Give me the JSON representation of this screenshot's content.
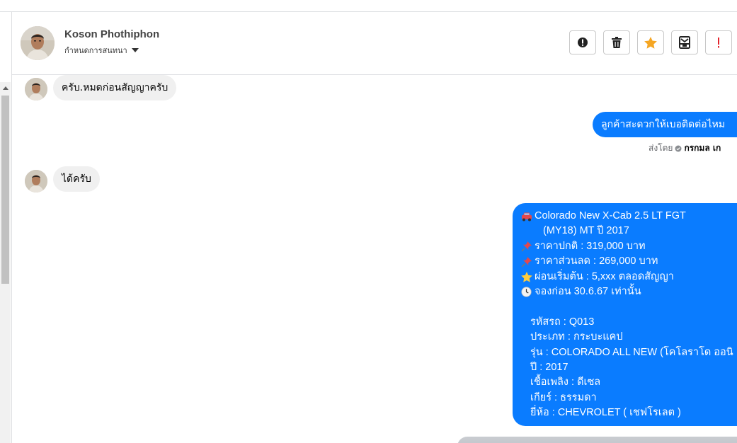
{
  "header": {
    "contact_name": "Koson Phothiphon",
    "conversation_setting": "กำหนดการสนทนา"
  },
  "messages": [
    {
      "direction": "in",
      "text": "ครับ.หมดก่อนสัญญาครับ"
    },
    {
      "direction": "out",
      "text": "ลูกค้าสะดวกให้เบอติดต่อไหม"
    },
    {
      "direction": "in",
      "text": "ได้ครับ"
    }
  ],
  "sent_by": {
    "prefix": "ส่งโดย",
    "name": "กรกมล เก"
  },
  "car_message": {
    "title_line1": "Colorado New X-Cab 2.5 LT FGT",
    "title_line2": "(MY18) MT ปี 2017",
    "normal_price": "ราคาปกติ : 319,000 บาท",
    "discount_price": "ราคาส่วนลด : 269,000 บาท",
    "installment": "ผ่อนเริ่มต้น : 5,xxx ตลอดสัญญา",
    "booking": "จองก่อน 30.6.67 เท่านั้น",
    "details": [
      "รหัสรถ : Q013",
      "ประเภท : กระบะแคป",
      "รุ่น : COLORADO ALL NEW (โคโลราโด ออนิ",
      "ปี : 2017",
      "เชื้อเพลิง : ดีเซล",
      "เกียร์ : ธรรมดา",
      "ยี่ห้อ : CHEVROLET ( เชฟโรเลต )"
    ]
  },
  "colors": {
    "outgoing_bubble": "#0a7cff",
    "incoming_bubble": "#f0f0f0",
    "star": "#f5a623",
    "alert_red": "#e4232c"
  },
  "icons": [
    "avatar",
    "caret-down-icon",
    "exclamation-circle-icon",
    "trash-icon",
    "star-icon",
    "archive-icon",
    "exclamation-icon",
    "car-icon",
    "pushpin-icon",
    "star-emoji-icon",
    "clock-icon",
    "check-circle-icon",
    "scroll-up-arrow-icon"
  ]
}
